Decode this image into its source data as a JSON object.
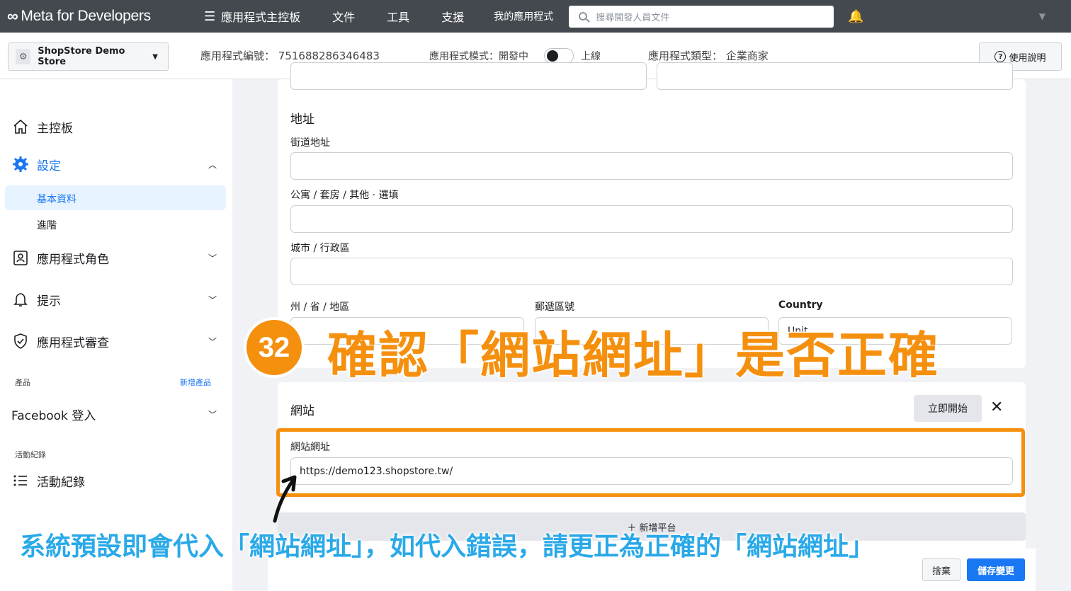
{
  "topnav": {
    "brand": "Meta for Developers",
    "items": [
      "應用程式主控板",
      "文件",
      "工具",
      "支援",
      "我的應用程式"
    ],
    "search_placeholder": "搜尋開發人員文件"
  },
  "appbar": {
    "app_name": "ShopStore Demo Store",
    "app_id_label": "應用程式編號：",
    "app_id": "751688286346483",
    "mode_label": "應用程式模式：開發中",
    "mode_live": "上線",
    "type_label": "應用程式類型：",
    "type_value": "企業商家",
    "help": "使用說明"
  },
  "sidebar": {
    "dashboard": "主控板",
    "settings": "設定",
    "basic": "基本資料",
    "advanced": "進階",
    "roles": "應用程式角色",
    "alerts": "提示",
    "review": "應用程式審查",
    "products_label": "產品",
    "add_product": "新增產品",
    "fb_login": "Facebook 登入",
    "activity_label": "活動紀錄",
    "activity": "活動紀錄"
  },
  "address": {
    "title": "地址",
    "street_label": "街道地址",
    "apt_label": "公寓 / 套房 / 其他 · 選填",
    "city_label": "城市 / 行政區",
    "state_label": "州 / 省 / 地區",
    "zip_label": "郵遞區號",
    "country_label": "Country",
    "country_value": "Unit"
  },
  "website": {
    "title": "網站",
    "start": "立即開始",
    "url_label": "網站網址",
    "url_value": "https://demo123.shopstore.tw/",
    "add_platform": "＋ 新增平台"
  },
  "footer": {
    "discard": "捨棄",
    "save": "儲存變更"
  },
  "annotation": {
    "step": "32",
    "title": "確認「網站網址」是否正確",
    "note": "系統預設即會代入「網站網址」，如代入錯誤，請更正為正確的「網站網址」"
  },
  "colors": {
    "accent": "#1877f2",
    "highlight": "#f5900f",
    "note": "#2aa9e8"
  }
}
